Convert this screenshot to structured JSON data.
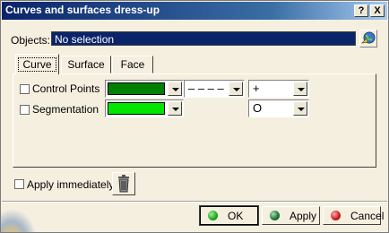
{
  "window": {
    "title": "Curves and surfaces dress-up",
    "help_label": "?",
    "close_label": "X"
  },
  "objects": {
    "label": "Objects:",
    "value": "No selection"
  },
  "tabs": [
    {
      "label": "Curve",
      "active": true
    },
    {
      "label": "Surface",
      "active": false
    },
    {
      "label": "Face",
      "active": false
    }
  ],
  "curve_panel": {
    "control_points": {
      "label": "Control Points",
      "checked": false,
      "color": "#008000",
      "linetype": "– – – –",
      "symbol": "+"
    },
    "segmentation": {
      "label": "Segmentation",
      "checked": false,
      "color": "#00e600",
      "symbol": "O"
    }
  },
  "apply_immediately": {
    "label": "Apply immediately",
    "checked": false
  },
  "buttons": {
    "ok": "OK",
    "apply": "Apply",
    "cancel": "Cancel"
  },
  "colors": {
    "ok_dot": "#1aa81a",
    "apply_dot": "#1e7a3a",
    "cancel_dot": "#d02020"
  },
  "icons": {
    "objects_button": "selection-globe-icon",
    "trash_button": "trash-icon"
  }
}
